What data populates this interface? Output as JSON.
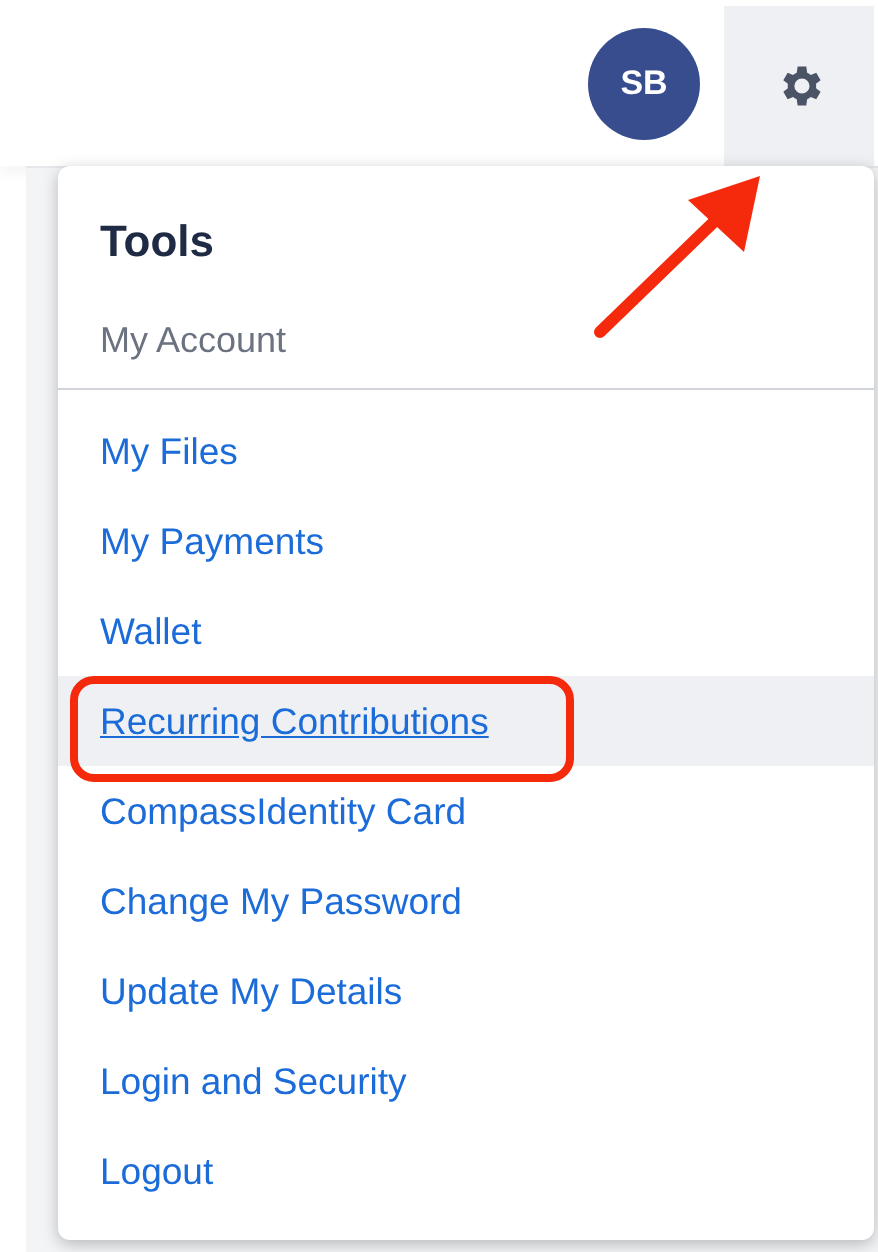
{
  "header": {
    "avatar_initials": "SB"
  },
  "menu": {
    "title": "Tools",
    "section": "My Account",
    "items": [
      {
        "label": "My Files",
        "selected": false
      },
      {
        "label": "My Payments",
        "selected": false
      },
      {
        "label": "Wallet",
        "selected": false
      },
      {
        "label": "Recurring Contributions",
        "selected": true
      },
      {
        "label": "CompassIdentity Card",
        "selected": false
      },
      {
        "label": "Change My Password",
        "selected": false
      },
      {
        "label": "Update My Details",
        "selected": false
      },
      {
        "label": "Login and Security",
        "selected": false
      },
      {
        "label": "Logout",
        "selected": false
      }
    ]
  }
}
